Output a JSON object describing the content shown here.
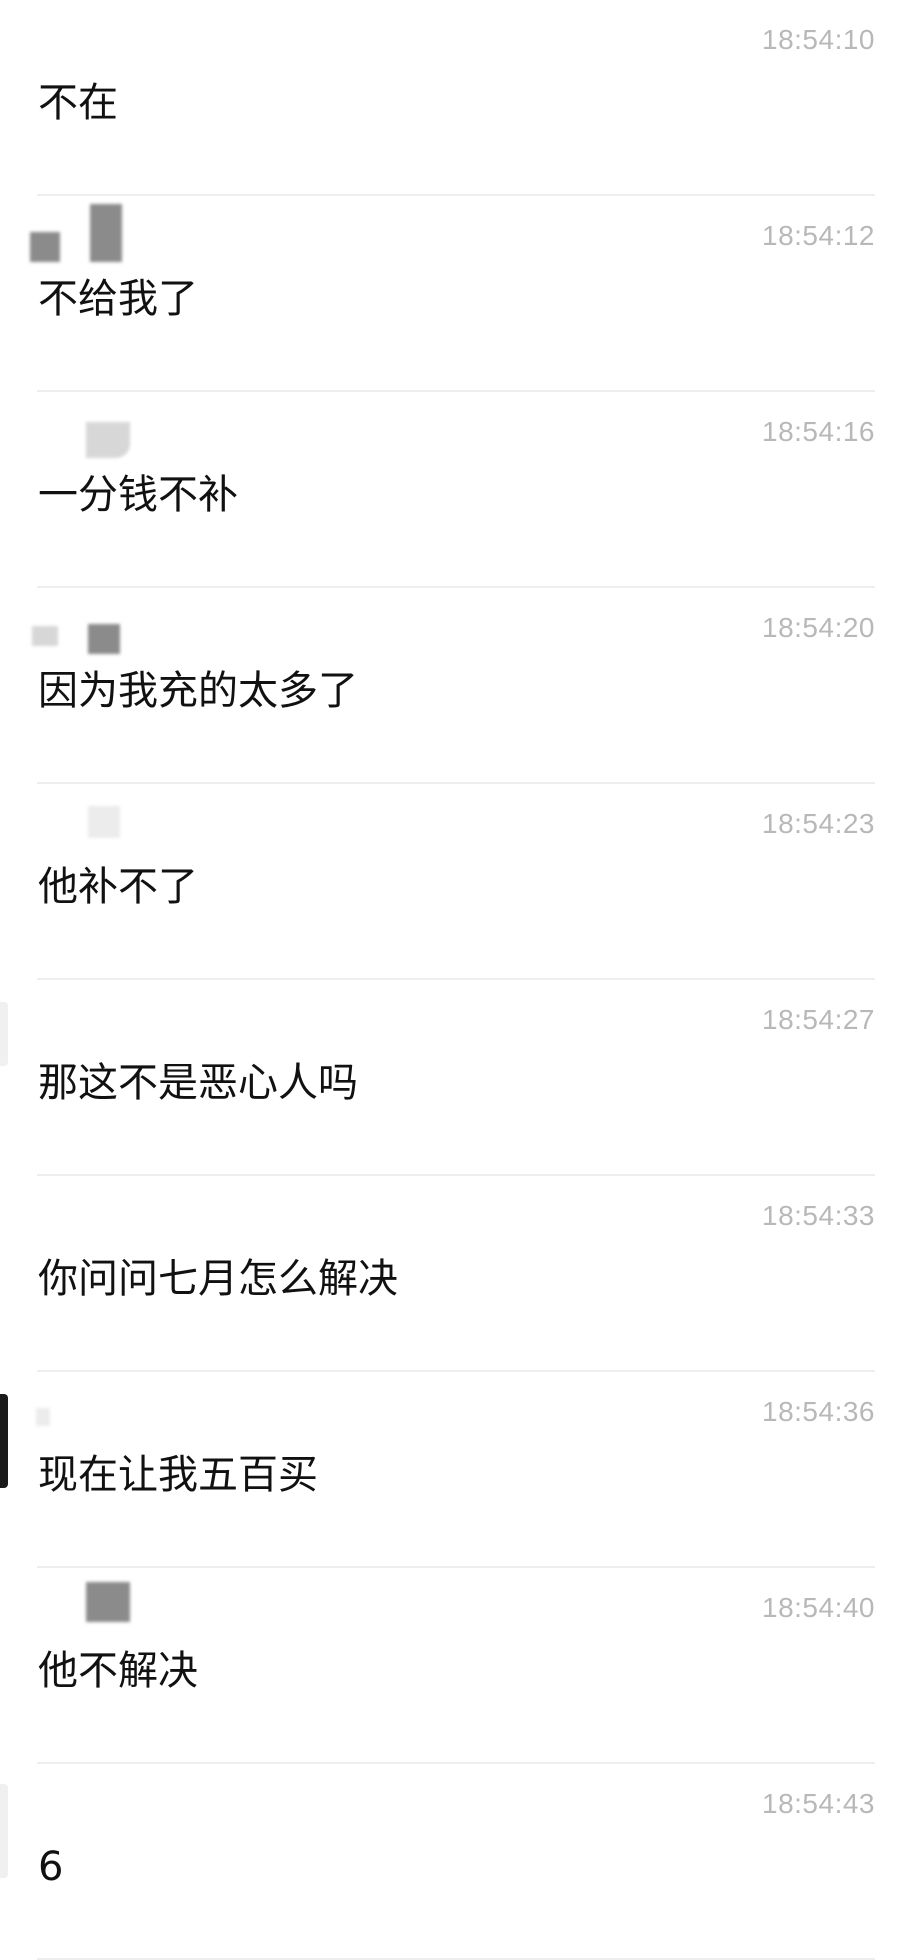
{
  "messages": [
    {
      "time": "18:54:10",
      "text": "不在"
    },
    {
      "time": "18:54:12",
      "text": "不给我了"
    },
    {
      "time": "18:54:16",
      "text": "一分钱不补"
    },
    {
      "time": "18:54:20",
      "text": "因为我充的太多了"
    },
    {
      "time": "18:54:23",
      "text": "他补不了"
    },
    {
      "time": "18:54:27",
      "text": "那这不是恶心人吗"
    },
    {
      "time": "18:54:33",
      "text": "你问问七月怎么解决"
    },
    {
      "time": "18:54:36",
      "text": "现在让我五百买"
    },
    {
      "time": "18:54:40",
      "text": "他不解决"
    },
    {
      "time": "18:54:43",
      "text": "6"
    }
  ],
  "colors": {
    "background": "#ffffff",
    "message_text": "#111111",
    "timestamp_text": "#b8b8b8",
    "divider": "#eeeeee"
  }
}
